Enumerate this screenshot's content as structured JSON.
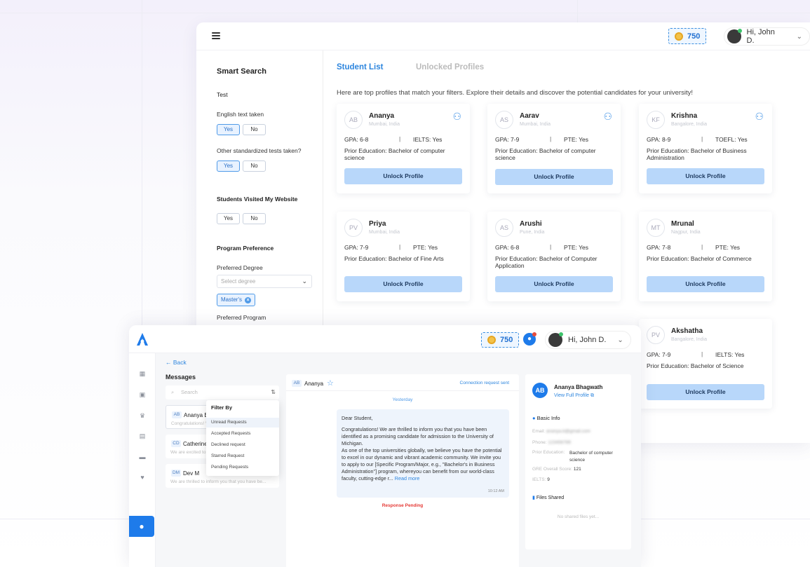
{
  "back_window": {
    "coins": "750",
    "user_greeting": "Hi, John D.",
    "tabs": [
      "Student List",
      "Unlocked Profiles"
    ],
    "intro": "Here are top profiles that match your filters. Explore their details and discover the potential candidates for your university!",
    "filters": {
      "title": "Smart Search",
      "section_test": "Test",
      "english_label": "English text taken",
      "other_tests_label": "Other standardized tests taken?",
      "visited_label": "Students Visited My Website",
      "program_pref": "Program Preference",
      "preferred_degree": "Preferred Degree",
      "degree_placeholder": "Select degree",
      "degree_chip": "Master's",
      "preferred_program": "Preferred Program",
      "yes": "Yes",
      "no": "No"
    },
    "cards": [
      {
        "initials": "AB",
        "name": "Ananya",
        "location": "Mumbai, India",
        "gpa": "GPA: 6-8",
        "test": "IELTS: Yes",
        "education": "Prior Education: Bachelor of computer science",
        "button": "Unlock Profile"
      },
      {
        "initials": "AS",
        "name": "Aarav",
        "location": "Mumbai, India",
        "gpa": "GPA: 7-9",
        "test": "PTE: Yes",
        "education": "Prior Education: Bachelor of computer science",
        "button": "Unlock Profile"
      },
      {
        "initials": "KF",
        "name": "Krishna",
        "location": "Bangalore, India",
        "gpa": "GPA: 8-9",
        "test": "TOEFL: Yes",
        "education": "Prior Education: Bachelor of Business Administration",
        "button": "Unlock Profile"
      },
      {
        "initials": "PV",
        "name": "Priya",
        "location": "Mumbai, India",
        "gpa": "GPA: 7-9",
        "test": "PTE: Yes",
        "education": "Prior Education: Bachelor of Fine Arts",
        "button": "Unlock Profile"
      },
      {
        "initials": "AS",
        "name": "Arushi",
        "location": "Pune, India",
        "gpa": "GPA: 6-8",
        "test": "PTE: Yes",
        "education": "Prior Education: Bachelor of Computer Application",
        "button": "Unlock Profile"
      },
      {
        "initials": "MT",
        "name": "Mrunal",
        "location": "Nagpur, India",
        "gpa": "GPA: 7-8",
        "test": "PTE: Yes",
        "education": "Prior Education: Bachelor of Commerce",
        "button": "Unlock Profile"
      },
      {
        "initials": "PV",
        "name": "Akshatha",
        "location": "Bangalore, India",
        "gpa": "GPA: 7-9",
        "test": "IELTS: Yes",
        "education": "Prior Education: Bachelor of Science",
        "button": "Unlock Profile"
      }
    ]
  },
  "front_window": {
    "coins": "750",
    "user_greeting": "Hi, John D.",
    "back": "Back",
    "messages_title": "Messages",
    "search_placeholder": "Search",
    "conversations": [
      {
        "initials": "AB",
        "name": "Ananya Bh",
        "preview": "Congratulations! We"
      },
      {
        "initials": "CD",
        "name": "Catherine",
        "preview": "We are excited to"
      },
      {
        "initials": "DM",
        "name": "Dev M",
        "preview": "We are thrilled to inform you that you have be..."
      }
    ],
    "filter_menu": {
      "title": "Filter By",
      "items": [
        "Unread Requests",
        "Accepted Requests",
        "Declined request",
        "Starred Request",
        "Pending Requests"
      ]
    },
    "chat": {
      "initials": "AB",
      "name": "Ananya",
      "status": "Connection request sent",
      "day": "Yesterday",
      "greeting": "Dear Student,",
      "para1": "Congratulations! We are thrilled to inform you that you have been identified as a promising candidate for admission to the University of Michigan.",
      "para2": "As one of the top universities globally, we believe you have the potential to excel in our dynamic and vibrant academic community. We invite you to apply to our [Specific Program/Major, e.g., \"Bachelor's in Business Administration\"] program, whereyou can benefit from our world-class faculty, cutting-edge r...",
      "read_more": "Read more",
      "time": "10:12 AM",
      "pending": "Response Pending"
    },
    "profile": {
      "initials": "AB",
      "name": "Ananya Bhagwath",
      "view_full": "View Full Profile",
      "basic_info": "Basic Info",
      "email_label": "Email:",
      "email_value": "ananya.b@gmail.com",
      "phone_label": "Phone:",
      "phone_value": "123456789",
      "edu_label": "Prior Education:",
      "edu_value": "Bachelor of computer science",
      "gre_label": "GRE Overall Score:",
      "gre_value": "121",
      "ielts_label": "IELTS:",
      "ielts_value": "9",
      "files_shared": "Files Shared",
      "no_files": "No shared files yet..."
    }
  },
  "colors": {
    "accent": "#2e86de",
    "unlock_btn": "#b8d7fa",
    "coin": "#f3c24a",
    "pending": "#e53935"
  }
}
